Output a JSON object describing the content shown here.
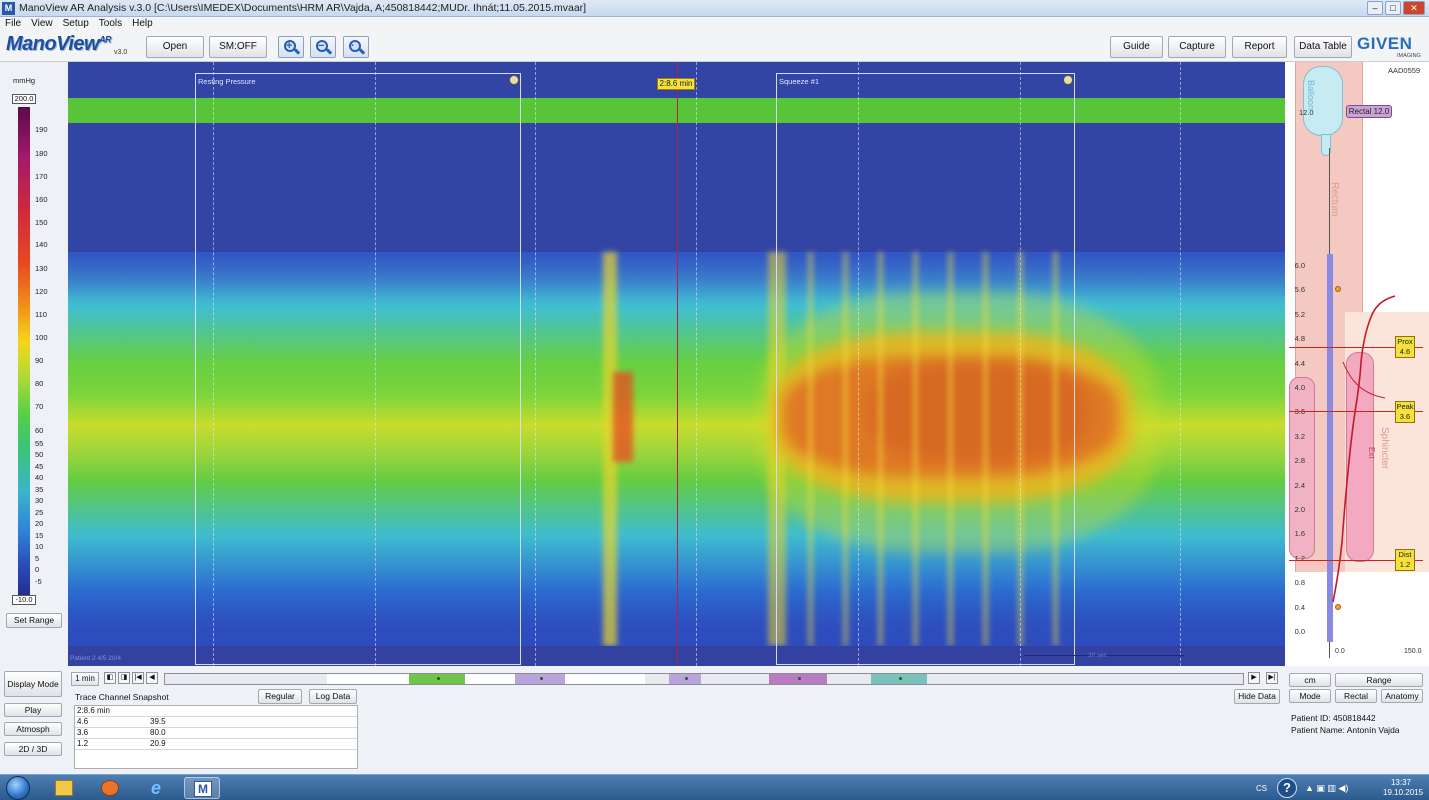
{
  "window": {
    "title": "ManoView AR Analysis v.3.0 [C:\\Users\\IMEDEX\\Documents\\HRM AR\\Vajda, A;450818442;MUDr. Ihnát;11.05.2015.mvaar]",
    "app_icon": "M",
    "controls": [
      "–",
      "□",
      "✕"
    ]
  },
  "menu": [
    "File",
    "View",
    "Setup",
    "Tools",
    "Help"
  ],
  "toolbar": {
    "logo_text": "ManoView",
    "logo_suffix": "AR",
    "logo_version": "v3.0",
    "open_label": "Open",
    "sm_label": "SM:OFF",
    "zoom_in_icon": "zoom-in-icon",
    "zoom_out_icon": "zoom-out-icon",
    "zoom_reset_icon": "zoom-reset-icon",
    "guide_label": "Guide",
    "capture_label": "Capture",
    "report_label": "Report",
    "datatable_label": "Data Table",
    "brand_text": "GIVEN",
    "brand_sub": "IMAGING"
  },
  "scale": {
    "unit": "mmHg",
    "max": "200.0",
    "min": "-10.0",
    "ticks": [
      "190",
      "180",
      "170",
      "160",
      "150",
      "140",
      "130",
      "120",
      "110",
      "100",
      "90",
      "80",
      "70",
      "60",
      "55",
      "50",
      "45",
      "40",
      "35",
      "30",
      "25",
      "20",
      "15",
      "10",
      "5",
      "0",
      "-5"
    ],
    "set_range_label": "Set Range"
  },
  "plot": {
    "boxes": [
      {
        "label": "Resting Pressure"
      },
      {
        "label": "Squeeze #1"
      }
    ],
    "cursor_label": "2:8.6 min",
    "bottom_note": "Patient 2 4/5 20/4",
    "scale_label": "30 sec"
  },
  "anatomy": {
    "id": "AAD0559",
    "balloon_label": "Balloon",
    "rectum_label": "Rectum",
    "sphincter_label": "Sphincter",
    "ext_label": "Ext",
    "depth_top": "12.0",
    "rectal_tag": "Rectal 12.0",
    "y_ticks": [
      "6.0",
      "5.6",
      "5.2",
      "4.8",
      "4.4",
      "4.0",
      "3.6",
      "3.2",
      "2.8",
      "2.4",
      "2.0",
      "1.6",
      "1.2",
      "0.8",
      "0.4",
      "0.0"
    ],
    "prox": {
      "label": "Prox",
      "value": "4.6"
    },
    "peak": {
      "label": "Peak",
      "value": "3.6"
    },
    "dist": {
      "label": "Dist",
      "value": "1.2"
    },
    "x_min": "0.0",
    "x_max": "150.0"
  },
  "timeline": {
    "one_min_label": "1 min",
    "nav_start_icons": [
      "◧",
      "◨",
      "|◀",
      "◀"
    ],
    "nav_end_icons": [
      "▶",
      "▶|"
    ],
    "segments": [
      {
        "color": "#ffffff"
      },
      {
        "color": "#71c44a"
      },
      {
        "color": "#ffffff"
      },
      {
        "color": "#b9a5dc"
      },
      {
        "color": "#ffffff"
      },
      {
        "color": "#e8eaee"
      },
      {
        "color": "#b9a5dc"
      },
      {
        "color": "#e8eaee"
      },
      {
        "color": "#b77cc2"
      },
      {
        "color": "#e8eaee"
      },
      {
        "color": "#7ac2b9"
      }
    ],
    "hide_data_label": "Hide Data"
  },
  "left_controls": {
    "display_mode": "Display Mode",
    "play": "Play",
    "atmosph": "Atmosph",
    "view_2d3d": "2D / 3D"
  },
  "snapshot": {
    "title": "Trace Channel Snapshot",
    "regular_label": "Regular",
    "log_label": "Log Data",
    "time": "2:8.6 min",
    "rows": [
      {
        "pos": "4.6",
        "value": "39.5"
      },
      {
        "pos": "3.6",
        "value": "80.0"
      },
      {
        "pos": "1.2",
        "value": "20.9"
      }
    ]
  },
  "right_controls": {
    "cm": "cm",
    "range": "Range",
    "mode": "Mode",
    "rectal": "Rectal",
    "anatomy": "Anatomy"
  },
  "patient": {
    "id_line": "Patient ID: 450818442",
    "name_line": "Patient Name: Antonín Vajda"
  },
  "taskbar": {
    "items": [
      "start-orb",
      "explorer-icon",
      "media-player-icon",
      "internet-explorer-icon",
      "manoview-icon"
    ],
    "lang": "CS",
    "help": "?",
    "time": "13:37",
    "date": "19.10.2015"
  }
}
